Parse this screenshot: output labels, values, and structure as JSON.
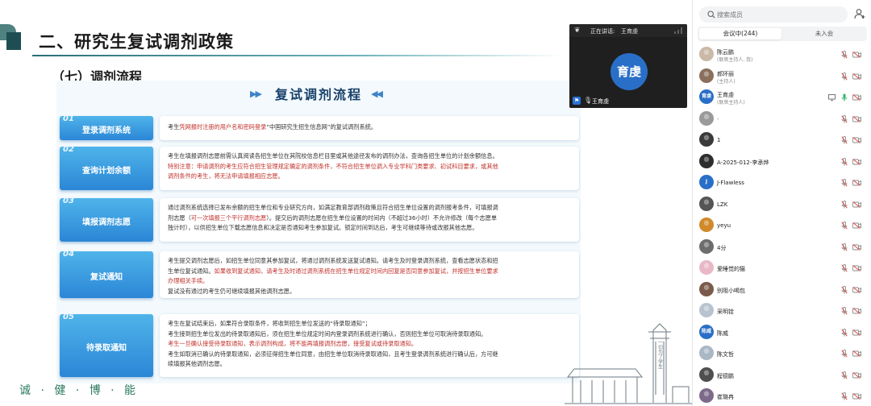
{
  "slide": {
    "title": "二、研究生复试调剂政策",
    "section": "（七）调剂流程",
    "flow_title": "复试调剂流程",
    "flow_arrows_left": "▶▶",
    "flow_arrows_right": "◀◀",
    "steps": [
      {
        "num": "01",
        "label": "登录调剂系统",
        "lines": [
          {
            "parts": [
              {
                "t": "考生",
                "c": ""
              },
              {
                "t": "凭网报时注册的用户名和密码登录",
                "c": "red"
              },
              {
                "t": "“中国研究生招生信息网”的复试调剂系统。",
                "c": ""
              }
            ]
          }
        ]
      },
      {
        "num": "02",
        "label": "查询计划余额",
        "lines": [
          {
            "parts": [
              {
                "t": "考生在填报调剂志愿前需认真阅读各招生单位在其院校信息栏目里或其他途径发布的调剂办法，查询各招生单位的计划余额信息。",
                "c": ""
              }
            ]
          },
          {
            "parts": [
              {
                "t": "特别注意：申请调剂的考生应符合招生管理规定确定的调剂条件，不符合招生单位调入专业学科门类要求、初试科目要求，或其他",
                "c": "red"
              }
            ]
          },
          {
            "parts": [
              {
                "t": "调剂条件的考生，将无法申请填报相应志愿。",
                "c": "red"
              }
            ]
          }
        ]
      },
      {
        "num": "03",
        "label": "填报调剂志愿",
        "lines": [
          {
            "parts": [
              {
                "t": "通过调剂系统选择已发布余额的招生单位和专业研究方向，如满足教育部调剂政策且符合招生单位设置的调剂报考条件，可填报调",
                "c": ""
              }
            ]
          },
          {
            "parts": [
              {
                "t": "剂志愿（",
                "c": ""
              },
              {
                "t": "可一次填报三个平行调剂志愿",
                "c": "red"
              },
              {
                "t": "）。提交后的调剂志愿在招生单位设置的时间内（不超过36小时）不允许修改（每个志愿单",
                "c": ""
              }
            ]
          },
          {
            "parts": [
              {
                "t": "独计时），以供招生单位下载志愿信息和决定是否通知考生参加复试。锁定时间到达后，考生可继续等待或改报其他志愿。",
                "c": ""
              }
            ]
          }
        ]
      },
      {
        "num": "04",
        "label": "复试通知",
        "lines": [
          {
            "parts": [
              {
                "t": "考生提交调剂志愿后，如招生单位同意其参加复试，将通过调剂系统发送复试通知。请考生及时登录调剂系统，查看志愿状态和招",
                "c": ""
              }
            ]
          },
          {
            "parts": [
              {
                "t": "生单位复试通知。",
                "c": ""
              },
              {
                "t": "如果收到复试通知，请考生及时通过调剂系统在招生单位规定时间内回复是否同意参加复试，并按招生单位要求",
                "c": "red"
              }
            ]
          },
          {
            "parts": [
              {
                "t": "办理相关手续。",
                "c": "red"
              }
            ]
          },
          {
            "parts": [
              {
                "t": "复试没有通过的考生仍可继续填报其他调剂志愿。",
                "c": ""
              }
            ]
          }
        ]
      },
      {
        "num": "05",
        "label": "待录取通知",
        "lines": [
          {
            "parts": [
              {
                "t": "考生在复试结束后，如果符合录取条件，将收到招生单位发送的“待录取通知”；",
                "c": ""
              }
            ]
          },
          {
            "parts": [
              {
                "t": "考生接到招生单位发出的待录取通知后，须在招生单位规定时间内登录调剂系统进行确认，否则招生单位可取消待录取通知。",
                "c": ""
              }
            ]
          },
          {
            "parts": [
              {
                "t": "考生一旦确认接受待录取通知，表示调剂构成，将不能再填报调剂志愿，接受复试或待录取通知。",
                "c": "red"
              }
            ]
          },
          {
            "parts": [
              {
                "t": "考生如取消已确认的待录取通知，必须征得招生单位同意，由招生单位取消待录取通知，且考生登录调剂系统进行确认后，方可继",
                "c": ""
              }
            ]
          },
          {
            "parts": [
              {
                "t": "续填报其他调剂志愿。",
                "c": ""
              }
            ]
          }
        ]
      }
    ],
    "motto": "诚 · 健 · 博 · 能"
  },
  "video": {
    "speaking_label": "正在讲话:",
    "speaker": "王育虔",
    "avatar_text": "育虔",
    "name": "王育虔",
    "avatar_color": "#2a6fc7"
  },
  "panel": {
    "search_placeholder": "搜索成员",
    "tabs": [
      "会议中(244)",
      "未入会"
    ],
    "members": [
      {
        "name": "陈云鹏",
        "role": "(联席主持人, 我)",
        "avatar": "photo",
        "color": "#c9b9a6",
        "initials": ""
      },
      {
        "name": "郝环丽",
        "role": "(主持人)",
        "avatar": "photo",
        "color": "#8a6f5c",
        "initials": ""
      },
      {
        "name": "王育虔",
        "role": "(联席主持人)",
        "avatar": "text",
        "color": "#2a6fc7",
        "initials": "育虔"
      },
      {
        "name": "·",
        "role": "",
        "avatar": "photo",
        "color": "#9a9a9a",
        "initials": ""
      },
      {
        "name": "1",
        "role": "",
        "avatar": "photo",
        "color": "#3a3a3a",
        "initials": ""
      },
      {
        "name": "A-2025-012-李承烨",
        "role": "",
        "avatar": "photo",
        "color": "#2d2d2d",
        "initials": ""
      },
      {
        "name": "J-Flawless",
        "role": "",
        "avatar": "text",
        "color": "#2a6fc7",
        "initials": "J"
      },
      {
        "name": "LZK",
        "role": "",
        "avatar": "photo",
        "color": "#555555",
        "initials": ""
      },
      {
        "name": "yeyu",
        "role": "",
        "avatar": "photo",
        "color": "#d08a2a",
        "initials": ""
      },
      {
        "name": "4分",
        "role": "",
        "avatar": "photo",
        "color": "#6d6d6d",
        "initials": ""
      },
      {
        "name": "爱睡觉的猫",
        "role": "",
        "avatar": "photo",
        "color": "#e9b8c7",
        "initials": ""
      },
      {
        "name": "别阻小喝包",
        "role": "",
        "avatar": "photo",
        "color": "#7a5a4a",
        "initials": ""
      },
      {
        "name": "采明铨",
        "role": "",
        "avatar": "photo",
        "color": "#b9c3cf",
        "initials": ""
      },
      {
        "name": "陈威",
        "role": "",
        "avatar": "text",
        "color": "#2a6fc7",
        "initials": "陈威"
      },
      {
        "name": "陈文哲",
        "role": "",
        "avatar": "photo",
        "color": "#aab7c4",
        "initials": ""
      },
      {
        "name": "程德鹏",
        "role": "",
        "avatar": "photo",
        "color": "#4f4f4f",
        "initials": ""
      },
      {
        "name": "崔璐冉",
        "role": "",
        "avatar": "photo",
        "color": "#7d6a8a",
        "initials": ""
      }
    ]
  }
}
